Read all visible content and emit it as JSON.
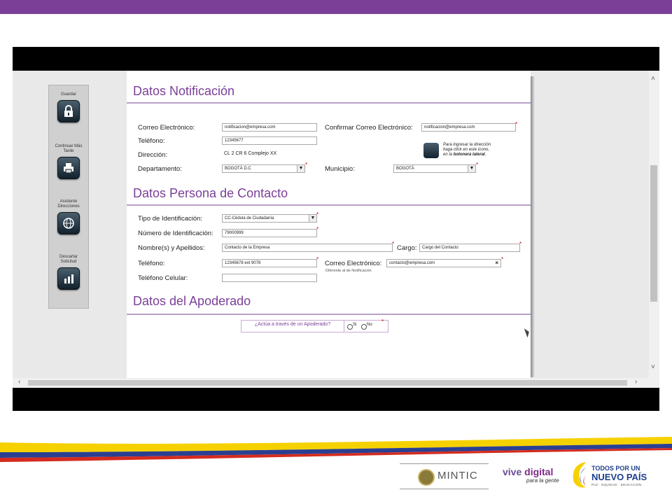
{
  "sidebar": {
    "items": [
      {
        "label": "Guardar",
        "icon": "lock-icon"
      },
      {
        "label": "Continuar Más Tarde",
        "icon": "printer-icon"
      },
      {
        "label": "Asistente Direcciones",
        "icon": "globe-icon"
      },
      {
        "label": "Descartar Solicitud",
        "icon": "bar-chart-icon"
      }
    ]
  },
  "notificacion": {
    "title": "Datos Notificación",
    "email_label": "Correo Electrónico:",
    "email_value": "notificacion@empresa.com",
    "confirm_label": "Confirmar Correo Electrónico:",
    "confirm_value": "notificacion@empresa.com",
    "phone_label": "Teléfono:",
    "phone_value": "12345677",
    "address_label": "Dirección:",
    "address_value": "CL 2 CR 6 Complejo XX",
    "dept_label": "Departamento:",
    "dept_value": "BOGOTÁ D.C",
    "municipio_label": "Municipio:",
    "municipio_value": "BOGOTÁ",
    "hint_line1": "Para ingresar la dirección",
    "hint_line2": "haga click en este ícono,",
    "hint_line3_pre": "en la ",
    "hint_line3_bold": "botonera lateral",
    "hint_line3_post": "."
  },
  "contacto": {
    "title": "Datos Persona de Contacto",
    "id_type_label": "Tipo de Identificación:",
    "id_type_value": "CC-Cédula de Ciudadanía",
    "id_number_label": "Número de Identificación:",
    "id_number_value": "79000999",
    "name_label": "Nombre(s) y Apellidos:",
    "name_value": "Contacto de la Empresa",
    "cargo_label": "Cargo:",
    "cargo_value": "Cargo del Contacto",
    "phone_label": "Teléfono:",
    "phone_value": "12345678 ext 9078",
    "email_label": "Correo Electrónico:",
    "email_value": "contacto@empresa.com",
    "email_note": "Diferente al de Notificación",
    "mobile_label": "Teléfono Celular:",
    "mobile_value": ""
  },
  "apoderado": {
    "title": "Datos del Apoderado",
    "question": "¿Actúa a través de un Apoderado?",
    "yes": "Si",
    "no": "No"
  },
  "footer": {
    "mintic": "MINTIC",
    "vive_1": "vive ",
    "vive_2": "digital",
    "vive_sub": "para la gente",
    "todos_1": "TODOS POR UN",
    "todos_2": "NUEVO PAÍS",
    "todos_3": "PAZ · EQUIDAD · EDUCACIÓN"
  },
  "colors": {
    "brand_purple": "#7b3f98",
    "required": "#cc0000"
  }
}
